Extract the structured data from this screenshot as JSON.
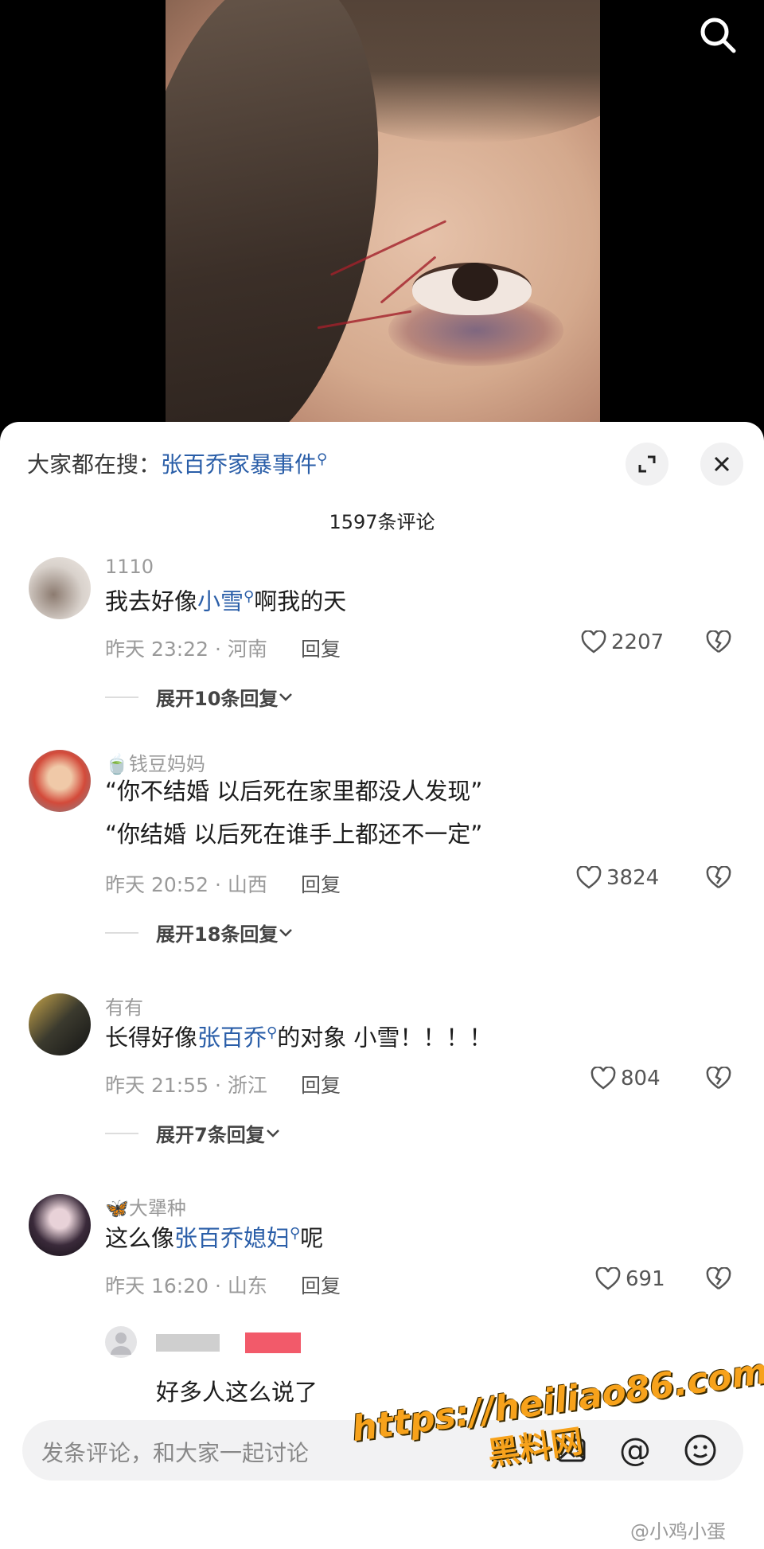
{
  "topbar": {
    "prefix": "大家都在搜：",
    "keyword": "张百乔家暴事件",
    "search_glyph": "⚲"
  },
  "count_label": "1597条评论",
  "comments": [
    {
      "user": "1110",
      "text_parts": [
        "我去好像",
        "小雪",
        "啊我的天"
      ],
      "time": "昨天 23:22 · 河南",
      "reply": "回复",
      "likes": "2207",
      "expand": "展开10条回复"
    },
    {
      "user": "钱豆妈妈",
      "line1": "“你不结婚 以后死在家里都没人发现”",
      "line2": "“你结婚 以后死在谁手上都还不一定”",
      "time": "昨天 20:52 · 山西",
      "reply": "回复",
      "likes": "3824",
      "expand": "展开18条回复"
    },
    {
      "user": "有有",
      "text_parts": [
        "长得好像",
        "张百乔",
        "的对象  小雪！！！！"
      ],
      "time": "昨天 21:55 · 浙江",
      "reply": "回复",
      "likes": "804",
      "expand": "展开7条回复"
    },
    {
      "user": "大犟种",
      "text_parts": [
        "这么像",
        "张百乔媳妇",
        "呢"
      ],
      "time": "昨天 16:20 · 山东",
      "reply": "回复",
      "likes": "691"
    }
  ],
  "subreply": {
    "text": "好多人这么说了"
  },
  "input": {
    "placeholder": "发条评论，和大家一起讨论"
  },
  "watermark": {
    "line1": "https://heiliao86.com",
    "line2": "黑料网"
  },
  "credit": "@小鸡小蛋",
  "colors": {
    "link": "#2a5ea8",
    "watermark": "#f7a21b"
  }
}
